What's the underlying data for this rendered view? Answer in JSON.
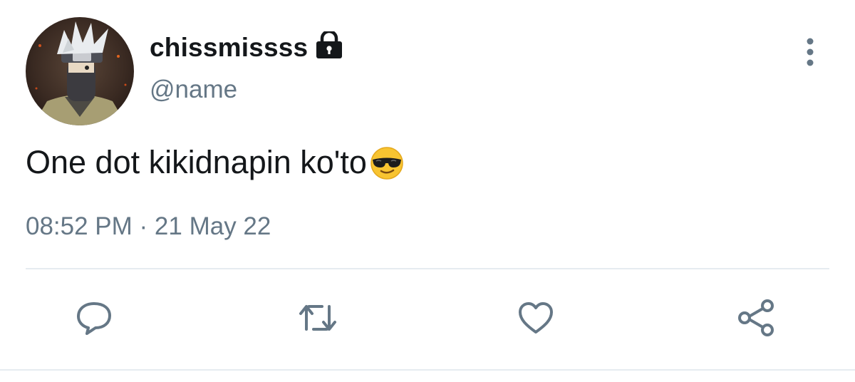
{
  "tweet": {
    "display_name": "chissmissss",
    "handle": "@name",
    "text": "One dot kikidnapin ko'to",
    "timestamp": "08:52 PM · 21 May 22"
  },
  "icons": {
    "lock": "lock-icon",
    "more": "more-vertical-icon",
    "emoji": "sunglasses-emoji-icon",
    "reply": "reply-icon",
    "retweet": "retweet-icon",
    "like": "heart-icon",
    "share": "share-icon"
  },
  "colors": {
    "text_primary": "#14171a",
    "text_secondary": "#657786",
    "icon_gray": "#657786",
    "divider": "#e6ecf0"
  }
}
